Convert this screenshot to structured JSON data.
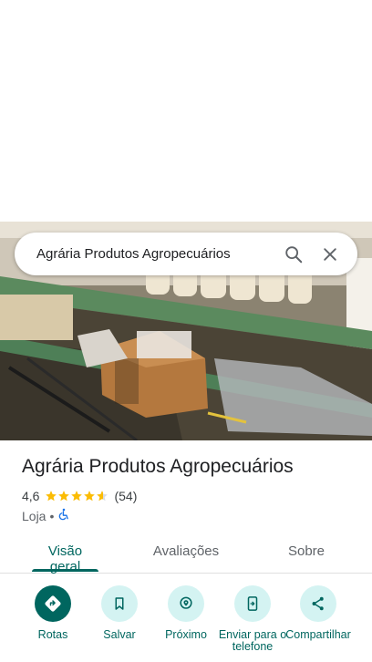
{
  "search": {
    "query": "Agrária Produtos Agropecuários"
  },
  "place": {
    "name": "Agrária Produtos Agropecuários",
    "rating": "4,6",
    "stars": 4.6,
    "reviews": "(54)",
    "category": "Loja",
    "separator": "•"
  },
  "tabs": [
    {
      "label": "Visão geral",
      "active": true
    },
    {
      "label": "Avaliações",
      "active": false
    },
    {
      "label": "Sobre",
      "active": false
    }
  ],
  "actions": [
    {
      "label": "Rotas",
      "icon": "directions-icon"
    },
    {
      "label": "Salvar",
      "icon": "bookmark-icon"
    },
    {
      "label": "Próximo",
      "icon": "nearby-icon"
    },
    {
      "label": "Enviar para o telefone",
      "icon": "send-to-phone-icon"
    },
    {
      "label": "Compartilhar",
      "icon": "share-icon"
    }
  ],
  "colors": {
    "accent": "#00665f",
    "star": "#fbbc04",
    "chip": "#d4f3f2"
  }
}
